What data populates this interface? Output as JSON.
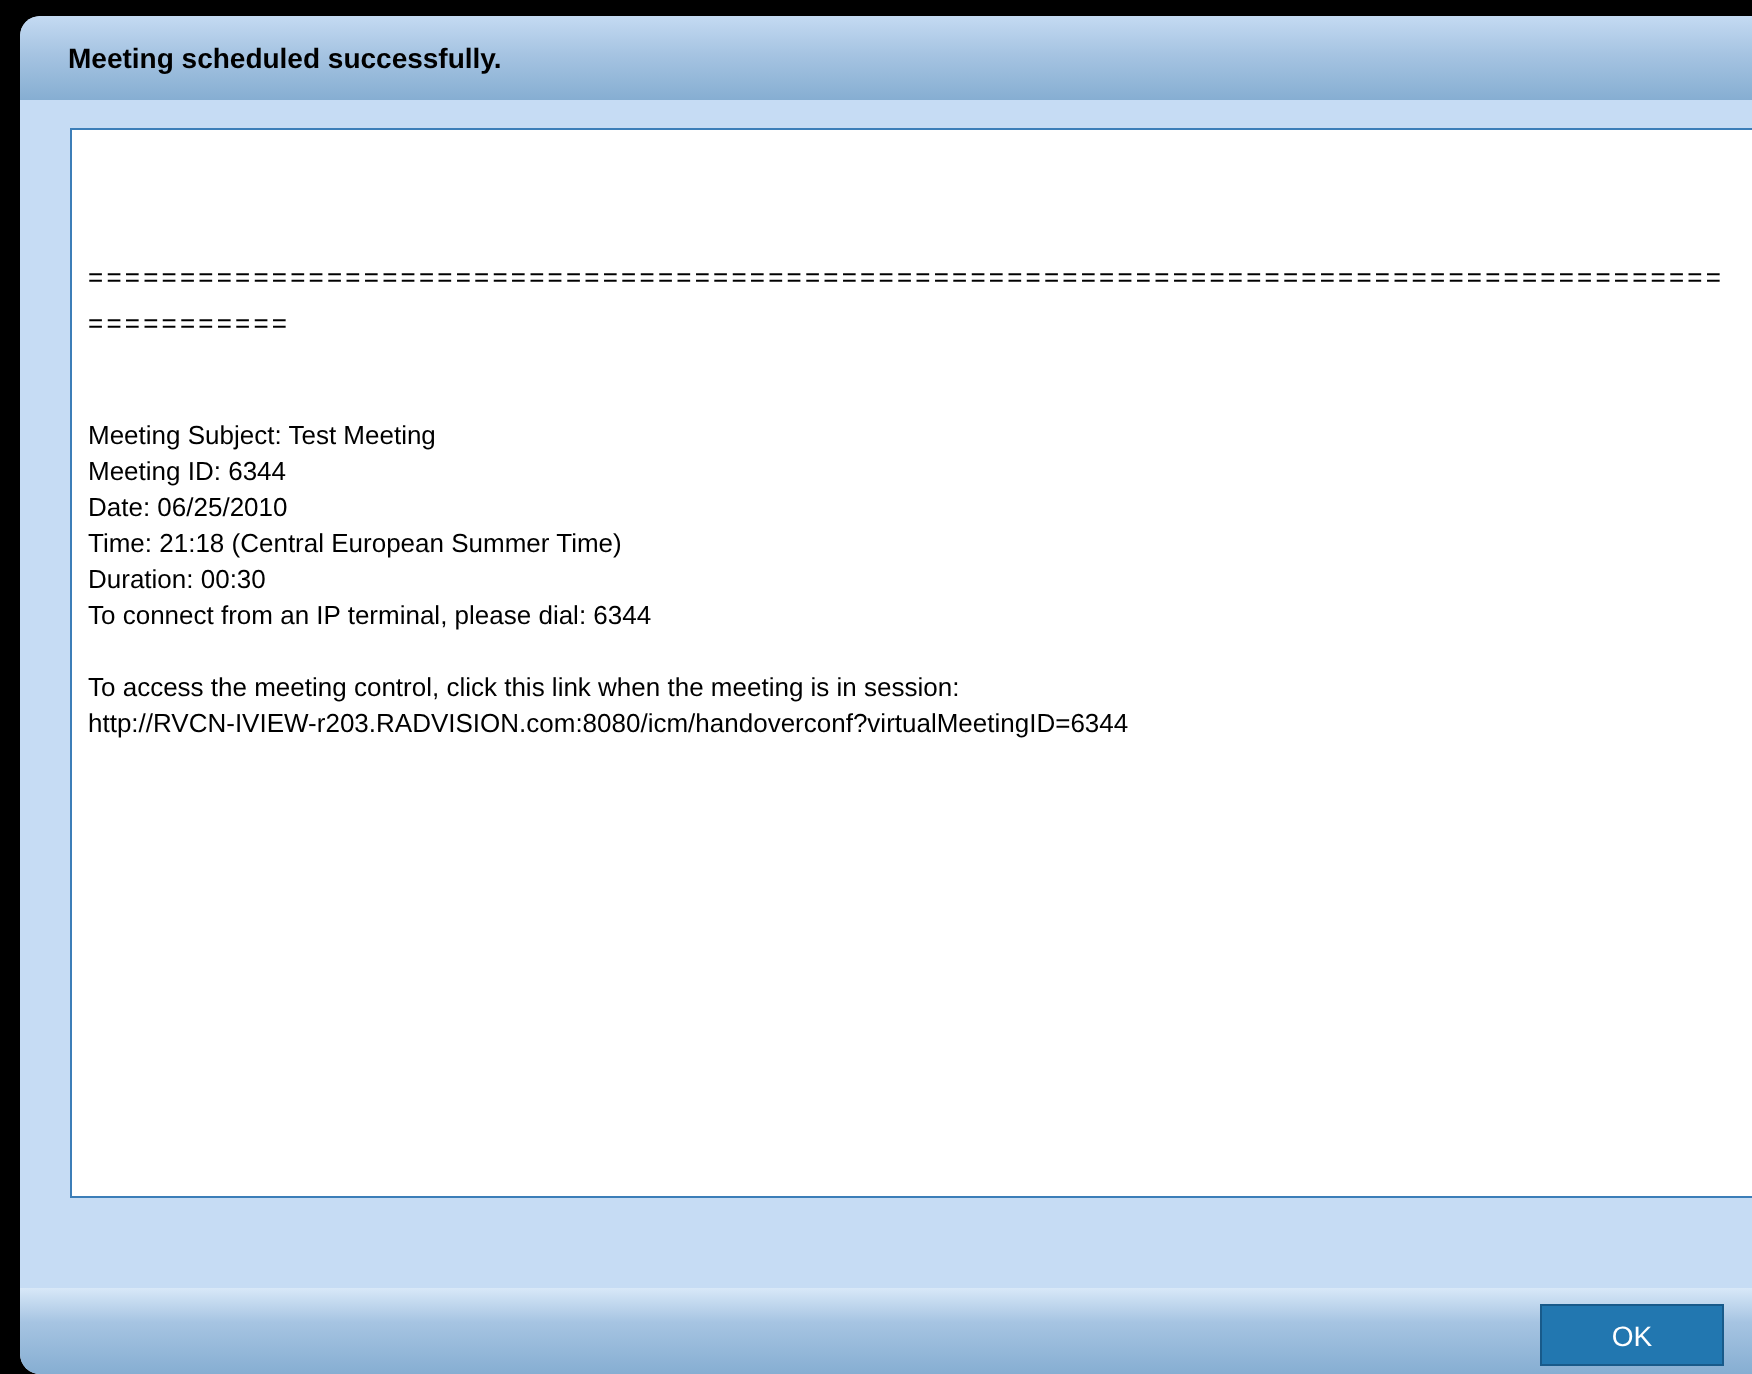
{
  "dialog": {
    "title": "Meeting scheduled successfully.",
    "message_lines": [
      {
        "kind": "separator",
        "text": "===================================================================================================="
      },
      {
        "kind": "gap"
      },
      {
        "kind": "line",
        "text": "Meeting Subject: Test Meeting"
      },
      {
        "kind": "line",
        "text": "Meeting ID: 6344"
      },
      {
        "kind": "line",
        "text": "Date: 06/25/2010"
      },
      {
        "kind": "line",
        "text": "Time: 21:18 (Central European Summer Time)"
      },
      {
        "kind": "line",
        "text": "Duration: 00:30"
      },
      {
        "kind": "line",
        "text": "To connect from an IP terminal, please dial: 6344"
      },
      {
        "kind": "gap"
      },
      {
        "kind": "line",
        "text": "To access the meeting control, click this link when the meeting is in session:"
      },
      {
        "kind": "line",
        "text": "http://RVCN-IVIEW-r203.RADVISION.com:8080/icm/handoverconf?virtualMeetingID=6344"
      }
    ],
    "buttons": [
      {
        "label": "OK"
      }
    ]
  }
}
